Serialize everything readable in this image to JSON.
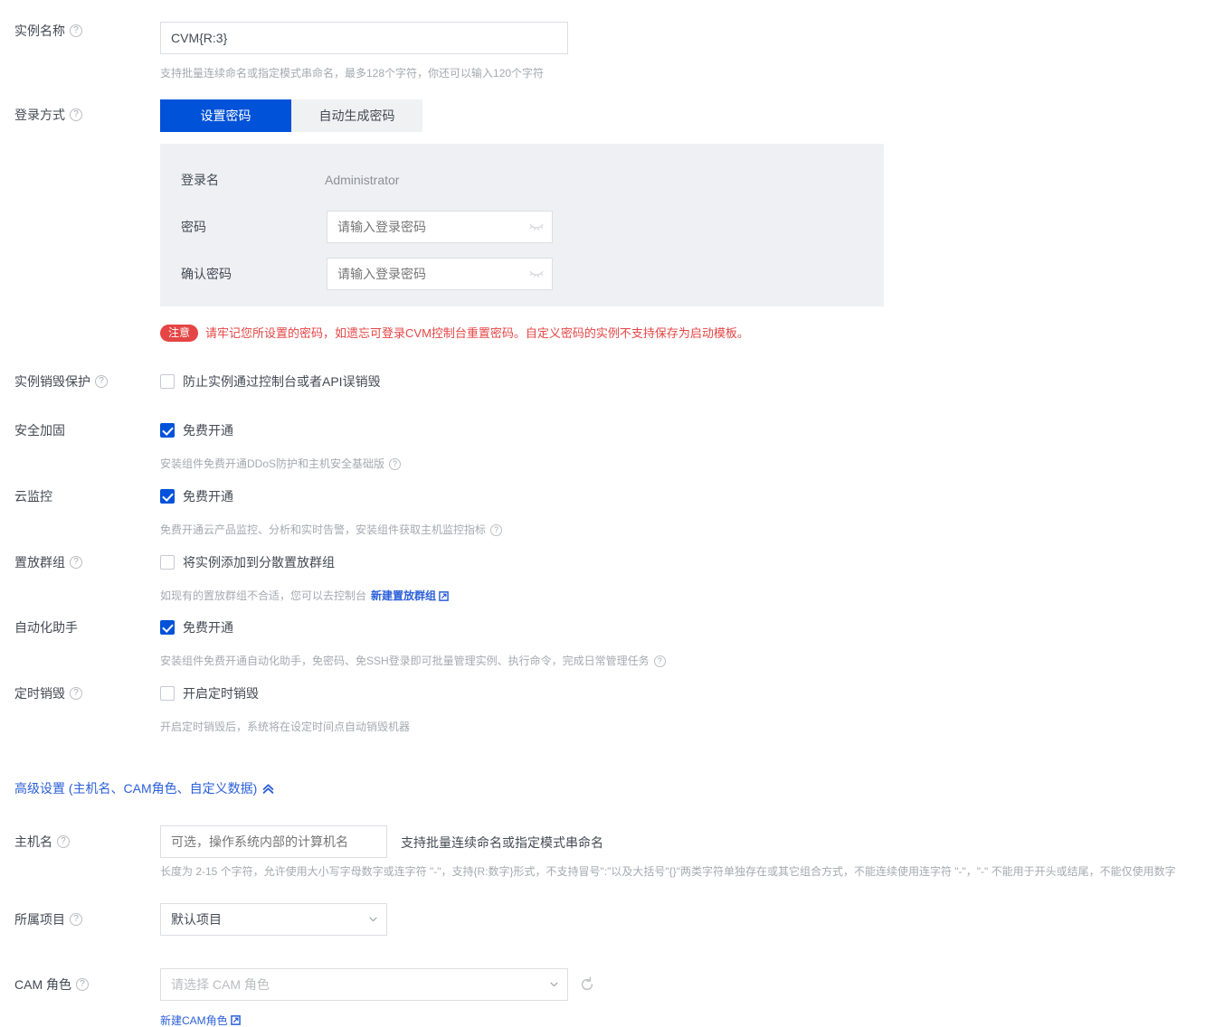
{
  "theme": {
    "primary": "#0052d9",
    "link": "#2b5fd9",
    "danger": "#e54545",
    "panel_bg": "#eef0f3",
    "label_color": "#444a54",
    "hint_color": "#a5a9b0"
  },
  "instance_name": {
    "label": "实例名称",
    "help_icon": "question-circle-icon",
    "value": "CVM{R:3}",
    "hint": "支持批量连续命名或指定模式串命名，最多128个字符，你还可以输入120个字符"
  },
  "login_mode": {
    "label": "登录方式",
    "help_icon": "question-circle-icon",
    "options": [
      {
        "label": "设置密码",
        "selected": true
      },
      {
        "label": "自动生成密码",
        "selected": false
      }
    ]
  },
  "credentials": {
    "username_label": "登录名",
    "username_value": "Administrator",
    "password_label": "密码",
    "password_value": "",
    "password_placeholder": "请输入登录密码",
    "confirm_label": "确认密码",
    "confirm_value": "",
    "confirm_placeholder": "请输入登录密码",
    "reveal_icon": "eye-closed-icon"
  },
  "notice": {
    "badge": "注意",
    "text": "请牢记您所设置的密码，如遗忘可登录CVM控制台重置密码。自定义密码的实例不支持保存为启动模板。"
  },
  "destroy_protection": {
    "label": "实例销毁保护",
    "help_icon": "question-circle-icon",
    "checkbox_label": "防止实例通过控制台或者API误销毁",
    "checked": false
  },
  "security_hardening": {
    "label": "安全加固",
    "checkbox_label": "免费开通",
    "checked": true,
    "hint": "安装组件免费开通DDoS防护和主机安全基础版",
    "hint_help_icon": "question-circle-icon"
  },
  "cloud_monitor": {
    "label": "云监控",
    "checkbox_label": "免费开通",
    "checked": true,
    "hint": "免费开通云产品监控、分析和实时告警，安装组件获取主机监控指标",
    "hint_help_icon": "question-circle-icon"
  },
  "placement_group": {
    "label": "置放群组",
    "help_icon": "question-circle-icon",
    "checkbox_label": "将实例添加到分散置放群组",
    "checked": false,
    "hint_prefix": "如现有的置放群组不合适，您可以去控制台",
    "link_label": "新建置放群组",
    "link_icon": "external-link-icon"
  },
  "automation_assistant": {
    "label": "自动化助手",
    "checkbox_label": "免费开通",
    "checked": true,
    "hint": "安装组件免费开通自动化助手，免密码、免SSH登录即可批量管理实例、执行命令，完成日常管理任务",
    "hint_help_icon": "question-circle-icon"
  },
  "scheduled_destroy": {
    "label": "定时销毁",
    "help_icon": "question-circle-icon",
    "checkbox_label": "开启定时销毁",
    "checked": false,
    "hint": "开启定时销毁后，系统将在设定时间点自动销毁机器"
  },
  "advanced": {
    "label": "高级设置 (主机名、CAM角色、自定义数据)",
    "toggle_icon": "chevron-up-icon",
    "expanded": true
  },
  "hostname": {
    "label": "主机名",
    "help_icon": "question-circle-icon",
    "value": "",
    "placeholder": "可选，操作系统内部的计算机名",
    "side_hint": "支持批量连续命名或指定模式串命名",
    "hint": "长度为 2-15 个字符，允许使用大小写字母数字或连字符 \"-\"，支持{R:数字}形式，不支持冒号\":\"以及大括号\"{}\"两类字符单独存在或其它组合方式，不能连续使用连字符 \"-\"，\"-\" 不能用于开头或结尾，不能仅使用数字"
  },
  "project": {
    "label": "所属项目",
    "help_icon": "question-circle-icon",
    "value": "默认项目",
    "caret_icon": "chevron-down-icon"
  },
  "cam_role": {
    "label": "CAM 角色",
    "help_icon": "question-circle-icon",
    "value": "",
    "placeholder": "请选择 CAM 角色",
    "caret_icon": "chevron-down-icon",
    "refresh_icon": "refresh-icon",
    "link_label": "新建CAM角色",
    "link_icon": "external-link-icon"
  }
}
